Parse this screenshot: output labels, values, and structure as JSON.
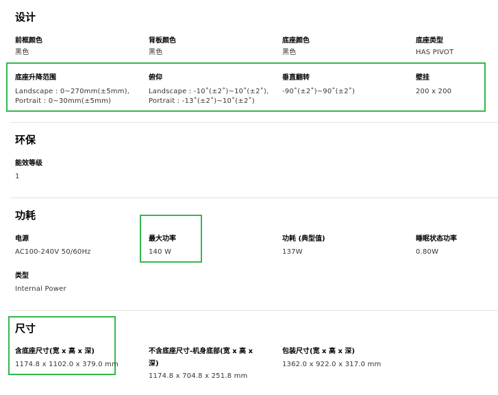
{
  "design": {
    "title": "设计",
    "specs": [
      {
        "label": "前框颜色",
        "value": [
          "黑色"
        ]
      },
      {
        "label": "背板颜色",
        "value": [
          "黑色"
        ]
      },
      {
        "label": "底座颜色",
        "value": [
          "黑色"
        ]
      },
      {
        "label": "底座类型",
        "value": [
          "HAS PIVOT"
        ]
      },
      {
        "label": "底座升降范围",
        "value": [
          "Landscape : 0~270mm(±5mm),",
          "Portrait : 0~30mm(±5mm)"
        ]
      },
      {
        "label": "俯仰",
        "value": [
          "Landscape : -10˚(±2˚)~10˚(±2˚),",
          "Portrait : -13˚(±2˚)~10˚(±2˚)"
        ]
      },
      {
        "label": "垂直翻转",
        "value": [
          "-90˚(±2˚)~90˚(±2˚)"
        ]
      },
      {
        "label": "壁挂",
        "value": [
          "200 x 200"
        ]
      }
    ]
  },
  "eco": {
    "title": "环保",
    "specs": [
      {
        "label": "能效等级",
        "value": [
          "1"
        ]
      }
    ]
  },
  "power": {
    "title": "功耗",
    "specs": [
      {
        "label": "电源",
        "value": [
          "AC100-240V 50/60Hz"
        ]
      },
      {
        "label": "最大功率",
        "value": [
          "140 W"
        ]
      },
      {
        "label": "功耗 (典型值)",
        "value": [
          "137W"
        ]
      },
      {
        "label": "睡眠状态功率",
        "value": [
          "0.80W"
        ]
      },
      {
        "label": "类型",
        "value": [
          "Internal Power"
        ]
      }
    ]
  },
  "size": {
    "title": "尺寸",
    "specs": [
      {
        "label": "含底座尺寸(宽 x 高 x 深)",
        "value": [
          "1174.8 x 1102.0 x 379.0 mm"
        ]
      },
      {
        "label": [
          "不含底座尺寸-机身底部(宽 x 高 x",
          "深)"
        ],
        "value": [
          "1174.8 x 704.8 x 251.8 mm"
        ]
      },
      {
        "label": "包装尺寸(宽 x 高 x 深)",
        "value": [
          "1362.0 x 922.0 x 317.0 mm"
        ]
      }
    ]
  },
  "colors": {
    "highlight": "#2fb84d",
    "separator": "#e2e2e2"
  }
}
